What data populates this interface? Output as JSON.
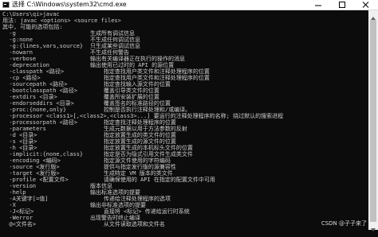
{
  "window": {
    "title": "选择 C:\\Windows\\system32\\cmd.exe",
    "text_color": "#cccccc",
    "background": "#0c0c0c"
  },
  "console": {
    "lines": [
      {
        "text": "C:\\Users\\qi>javac",
        "desc": ""
      },
      {
        "text": "用法: javac <options> <source files>",
        "desc": ""
      },
      {
        "text": "其中, 可能的选项包括:",
        "desc": ""
      },
      {
        "text": "  -g",
        "desc": "生成所有调试信息"
      },
      {
        "text": "  -g:none",
        "desc": "不生成任何调试信息"
      },
      {
        "text": "  -g:{lines,vars,source}",
        "desc": "只生成某些调试信息"
      },
      {
        "text": "  -nowarn",
        "desc": "不生成任何警告"
      },
      {
        "text": "  -verbose",
        "desc": "输出有关编译器正在执行的操作的消息"
      },
      {
        "text": "  -deprecation",
        "desc": "输出使用已过时的 API 的源位置"
      },
      {
        "text": "  -classpath <路径>",
        "desc": "    指定查找用户类文件和注释处理程序的位置"
      },
      {
        "text": "  -cp <路径>",
        "desc": "    指定查找用户类文件和注释处理程序的位置"
      },
      {
        "text": "  -sourcepath <路径>",
        "desc": "    指定查找输入源文件的位置"
      },
      {
        "text": "  -bootclasspath <路径>",
        "desc": "    覆盖引导类文件的位置"
      },
      {
        "text": "  -extdirs <目录>",
        "desc": "    覆盖所安装扩展的位置"
      },
      {
        "text": "  -endorseddirs <目录>",
        "desc": "    覆盖签名的标准路径的位置"
      },
      {
        "text": "  -proc:{none,only}",
        "desc": "    控制是否执行注释处理和/或编译。"
      },
      {
        "text": "  -processor <class1>[,<class2>,<class3>...] 要运行的注释处理程序的名称; 绕过默认的搜索进程",
        "desc": ""
      },
      {
        "text": "  -processorpath <路径>",
        "desc": "    指定查找注释处理程序的位置"
      },
      {
        "text": "  -parameters",
        "desc": "    生成元数据以用于方法参数的反射"
      },
      {
        "text": "  -d <目录>",
        "desc": "    指定放置生成的类文件的位置"
      },
      {
        "text": "  -s <目录>",
        "desc": "    指定放置生成的源文件的位置"
      },
      {
        "text": "  -h <目录>",
        "desc": "    指定放置生成的本机标头文件的位置"
      },
      {
        "text": "  -implicit:{none,class}",
        "desc": "    指定是否为隐式引用文件生成类文件"
      },
      {
        "text": "  -encoding <编码>",
        "desc": "    指定源文件使用的字符编码"
      },
      {
        "text": "  -source <发行版>",
        "desc": "    提供与指定发行版的源兼容性"
      },
      {
        "text": "  -target <发行版>",
        "desc": "    生成特定 VM 版本的类文件"
      },
      {
        "text": "  -profile <配置文件>",
        "desc": "    请确保使用的 API 在指定的配置文件中可用"
      },
      {
        "text": "  -version",
        "desc": "版本信息"
      },
      {
        "text": "  -help",
        "desc": "输出标准选项的提要"
      },
      {
        "text": "  -A关键字[=值]",
        "desc": "    传递给注释处理程序的选项"
      },
      {
        "text": "  -X",
        "desc": "输出非标准选项的提要"
      },
      {
        "text": "  -J<标记>",
        "desc": "    直接将 <标记> 传递给运行时系统"
      },
      {
        "text": "  -Werror",
        "desc": "出现警告时终止编译"
      },
      {
        "text": "  @<文件名>",
        "desc": "    从文件读取选项和文件名"
      }
    ]
  },
  "watermark": "CSDN @子子来了",
  "icons": [
    "cmd-app-icon",
    "minimize-icon",
    "maximize-icon",
    "close-icon",
    "scroll-up-arrow-icon",
    "scroll-down-arrow-icon"
  ]
}
